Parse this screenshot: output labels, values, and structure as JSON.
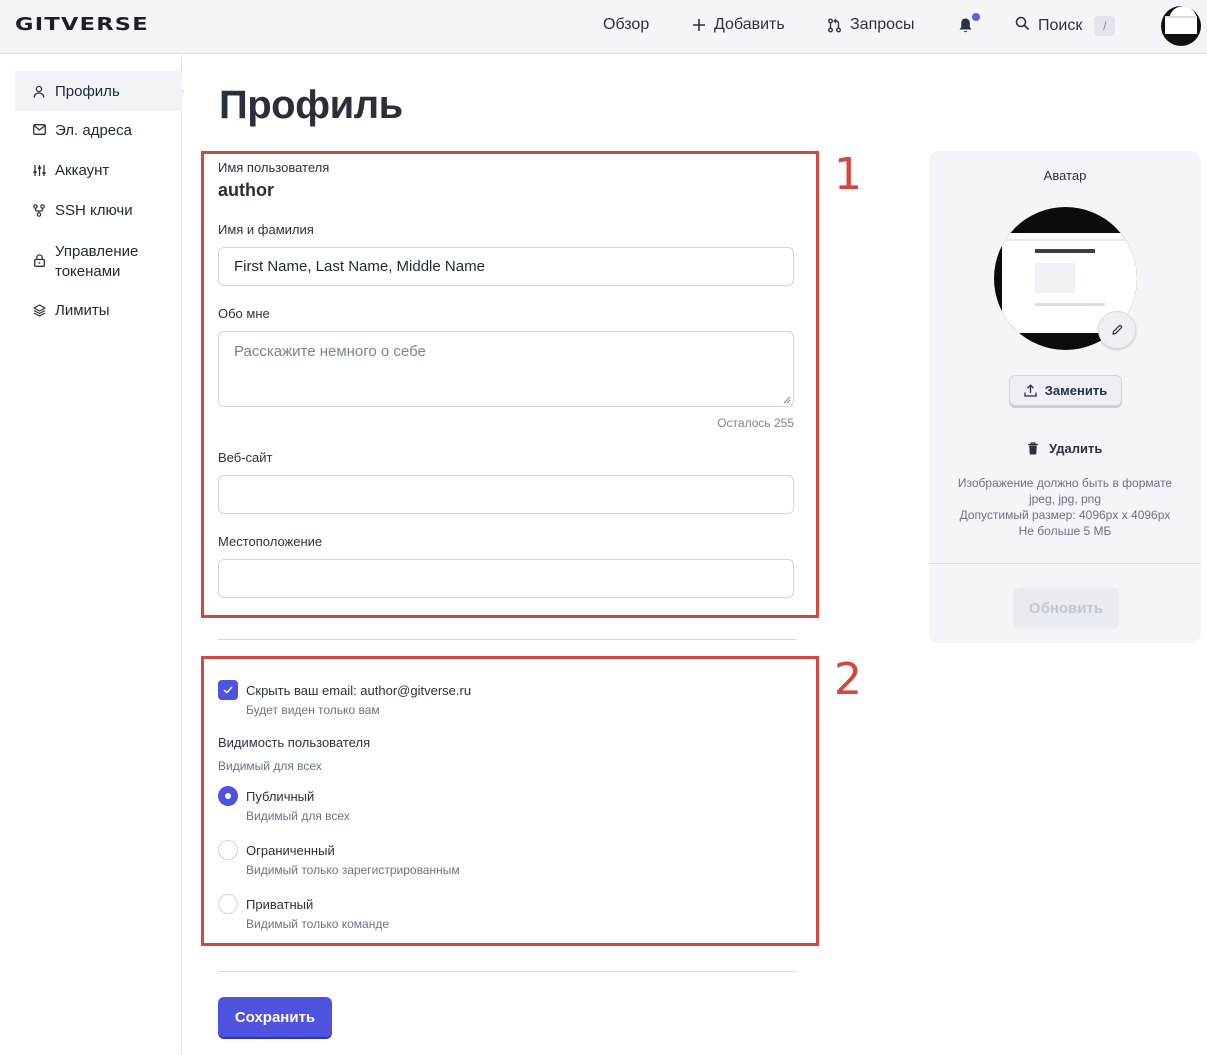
{
  "header": {
    "logo": "GITVERSE",
    "nav": {
      "overview": "Обзор",
      "add": "Добавить",
      "requests": "Запросы",
      "search": "Поиск",
      "search_shortcut": "/"
    }
  },
  "sidebar": {
    "items": [
      {
        "label": "Профиль",
        "icon": "user-icon",
        "active": true
      },
      {
        "label": "Эл. адреса",
        "icon": "mail-icon"
      },
      {
        "label": "Аккаунт",
        "icon": "sliders-icon"
      },
      {
        "label": "SSH ключи",
        "icon": "key-icon"
      },
      {
        "label": "Управление токенами",
        "icon": "lock-icon"
      },
      {
        "label": "Лимиты",
        "icon": "layers-icon"
      }
    ]
  },
  "page": {
    "title": "Профиль"
  },
  "form": {
    "username_label": "Имя пользователя",
    "username_value": "author",
    "fullname_label": "Имя и фамилия",
    "fullname_value": "First Name, Last Name, Middle Name",
    "about_label": "Обо мне",
    "about_placeholder": "Расскажите немного о себе",
    "about_remaining": "Осталось 255",
    "website_label": "Веб-сайт",
    "website_value": "",
    "location_label": "Местоположение",
    "location_value": ""
  },
  "privacy": {
    "hide_email_label": "Скрыть ваш email: author@gitverse.ru",
    "hide_email_sub": "Будет виден только вам",
    "hide_email_checked": true,
    "visibility_title": "Видимость пользователя",
    "visibility_sub": "Видимый для всех",
    "options": [
      {
        "label": "Публичный",
        "sub": "Видимый для всех",
        "selected": true
      },
      {
        "label": "Ограниченный",
        "sub": "Видимый только зарегистрированным",
        "selected": false
      },
      {
        "label": "Приватный",
        "sub": "Видимый только команде",
        "selected": false
      }
    ]
  },
  "actions": {
    "save": "Сохранить"
  },
  "annotations": {
    "box1": "1",
    "box2": "2"
  },
  "avatar_card": {
    "title": "Аватар",
    "replace": "Заменить",
    "delete": "Удалить",
    "hint_lines": [
      "Изображение должно быть в формате",
      "jpeg, jpg, png",
      "Допустимый размер: 4096px x 4096px",
      "Не больше 5 МБ"
    ],
    "update": "Обновить"
  },
  "colors": {
    "accent": "#4e54e0",
    "annotation_red": "#d2473f",
    "topbar_bg": "#f3f5f8"
  }
}
